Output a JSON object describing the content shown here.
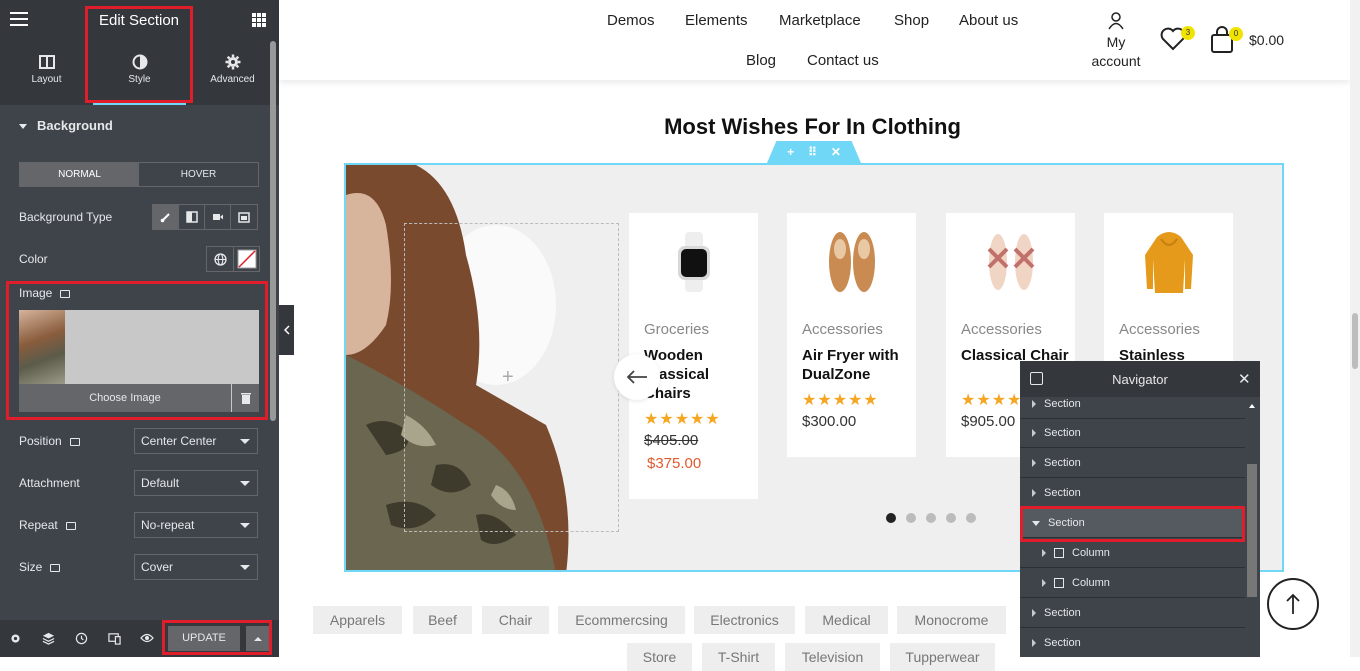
{
  "panel": {
    "title": "Edit Section",
    "tabs": [
      {
        "label": "Layout",
        "icon": "layout-icon"
      },
      {
        "label": "Style",
        "icon": "half-circle-icon"
      },
      {
        "label": "Advanced",
        "icon": "gear-icon"
      }
    ],
    "section_title": "Background",
    "state_tabs": [
      "NORMAL",
      "HOVER"
    ],
    "background_type_label": "Background Type",
    "color_label": "Color",
    "image_label": "Image",
    "choose_image": "Choose Image",
    "position_label": "Position",
    "position_value": "Center Center",
    "attachment_label": "Attachment",
    "attachment_value": "Default",
    "repeat_label": "Repeat",
    "repeat_value": "No-repeat",
    "size_label": "Size",
    "size_value": "Cover",
    "update_label": "UPDATE",
    "accent": "#71d7f7",
    "highlight": "#e01e2b"
  },
  "header": {
    "nav": [
      "Demos",
      "Elements",
      "Marketplace",
      "Shop",
      "About us",
      "Blog",
      "Contact us"
    ],
    "account": "My account",
    "wishlist_count": "3",
    "cart_count": "0",
    "cart_total": "$0.00"
  },
  "section": {
    "heading": "Most Wishes For In Clothing"
  },
  "products": [
    {
      "category": "Groceries",
      "name": "Wooden Classical Chairs",
      "old_price": "$405.00",
      "price": "$375.00"
    },
    {
      "category": "Accessories",
      "name": "Air Fryer with DualZone",
      "price": "$300.00"
    },
    {
      "category": "Accessories",
      "name": "Classical Chair",
      "price": "$905.00"
    },
    {
      "category": "Accessories",
      "name": "Stainless"
    }
  ],
  "tags": [
    "Apparels",
    "Beef",
    "Chair",
    "Ecommercsing",
    "Electronics",
    "Medical",
    "Monocrome",
    "Store",
    "T-Shirt",
    "Television",
    "Tupperwear"
  ],
  "navigator": {
    "title": "Navigator",
    "rows": [
      {
        "label": "Section",
        "type": "section"
      },
      {
        "label": "Section",
        "type": "section"
      },
      {
        "label": "Section",
        "type": "section"
      },
      {
        "label": "Section",
        "type": "section"
      },
      {
        "label": "Section",
        "type": "section-open"
      },
      {
        "label": "Column",
        "type": "column"
      },
      {
        "label": "Column",
        "type": "column"
      },
      {
        "label": "Section",
        "type": "section"
      },
      {
        "label": "Section",
        "type": "section"
      }
    ]
  }
}
